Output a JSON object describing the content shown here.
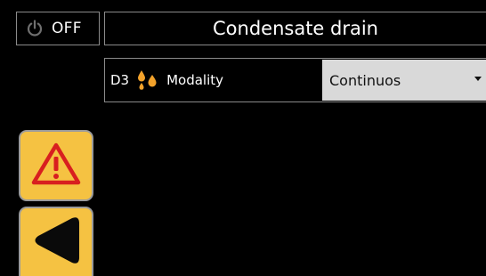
{
  "header": {
    "power_label": "OFF",
    "title": "Condensate drain"
  },
  "setting": {
    "code": "D3",
    "label": "Modality",
    "value": "Continuos"
  },
  "icons": {
    "power": "power-icon",
    "drops": "water-drops-icon",
    "alarm": "warning-triangle-icon",
    "back": "back-arrow-icon"
  },
  "colors": {
    "background": "#000000",
    "button_fill": "#f5c242",
    "drops": "#f2a22b",
    "warning_red": "#d81f1f",
    "dropdown_bg": "#d9d9d9"
  }
}
